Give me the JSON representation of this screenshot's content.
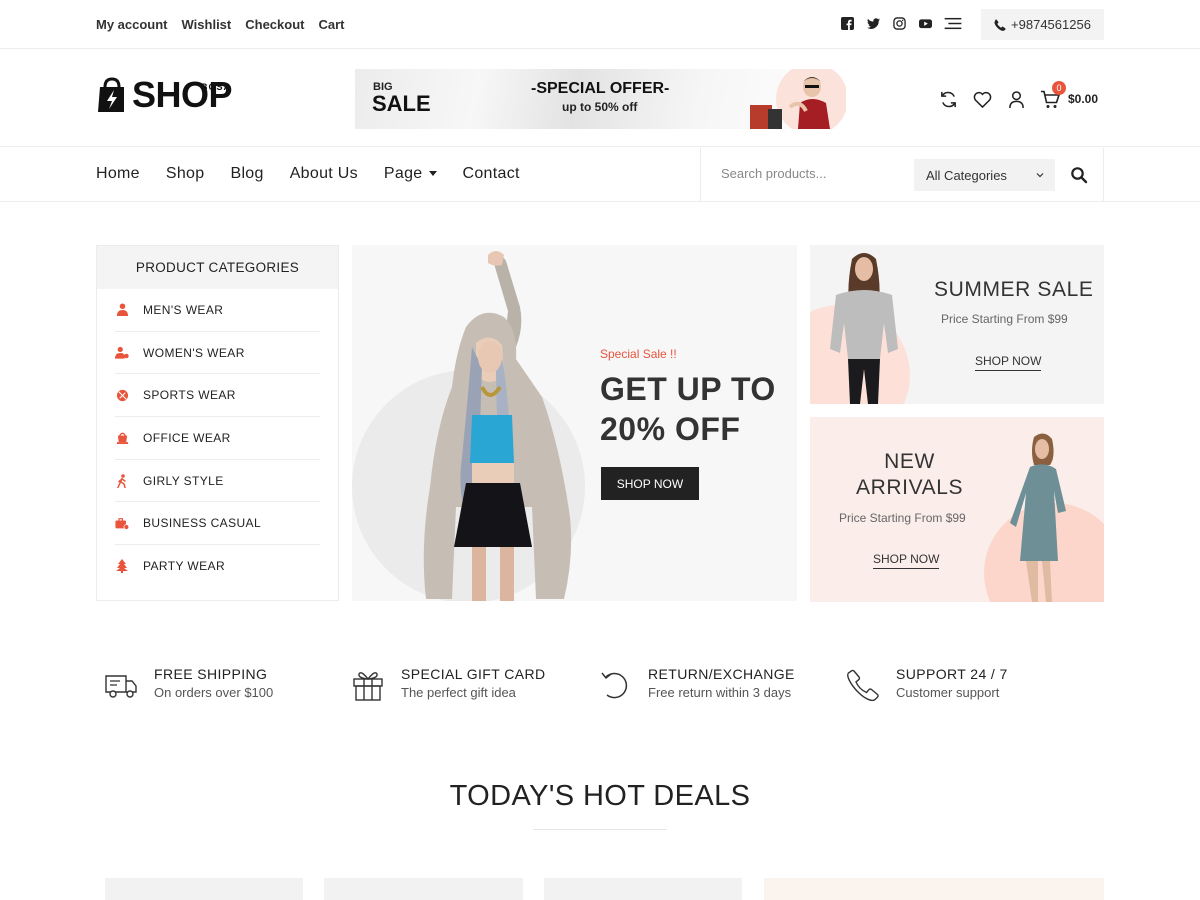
{
  "topbar": {
    "links": [
      "My account",
      "Wishlist",
      "Checkout",
      "Cart"
    ],
    "socials": [
      "facebook-icon",
      "twitter-icon",
      "instagram-icon",
      "youtube-icon",
      "menu-icon"
    ],
    "phone": "+9874561256"
  },
  "header": {
    "logo_text": "SHOP",
    "logo_sup": "BOSA",
    "banner": {
      "big": "BIG",
      "sale": "SALE",
      "offer": "-SPECIAL OFFER-",
      "upto": "up to 50% off"
    },
    "icons": [
      "refresh-icon",
      "heart-icon",
      "user-icon",
      "cart-icon"
    ],
    "cart_count": "0",
    "cart_total": "$0.00"
  },
  "nav": {
    "items": [
      "Home",
      "Shop",
      "Blog",
      "About Us",
      "Page",
      "Contact"
    ],
    "search_placeholder": "Search products...",
    "category_select": "All Categories"
  },
  "sidebar": {
    "title": "PRODUCT CATEGORIES",
    "items": [
      {
        "label": "MEN'S WEAR",
        "icon": "man-icon"
      },
      {
        "label": "WOMEN'S WEAR",
        "icon": "woman-icon"
      },
      {
        "label": "SPORTS WEAR",
        "icon": "ball-icon"
      },
      {
        "label": "OFFICE WEAR",
        "icon": "briefcase-icon"
      },
      {
        "label": "GIRLY STYLE",
        "icon": "walking-icon"
      },
      {
        "label": "BUSINESS CASUAL",
        "icon": "suitcase-icon"
      },
      {
        "label": "PARTY WEAR",
        "icon": "tree-icon"
      }
    ]
  },
  "hero": {
    "special": "Special Sale !!",
    "title_line1": "GET UP TO",
    "title_line2": "20% OFF",
    "button": "SHOP NOW"
  },
  "promos": {
    "summer": {
      "title": "SUMMER SALE",
      "sub": "Price Starting From $99",
      "link": "SHOP NOW"
    },
    "new": {
      "title_line1": "NEW",
      "title_line2": "ARRIVALS",
      "sub": "Price Starting From $99",
      "link": "SHOP NOW"
    }
  },
  "features": [
    {
      "title": "FREE SHIPPING",
      "sub": "On orders over $100",
      "icon": "truck-icon"
    },
    {
      "title": "SPECIAL GIFT CARD",
      "sub": "The perfect gift idea",
      "icon": "gift-icon"
    },
    {
      "title": "RETURN/EXCHANGE",
      "sub": "Free return within 3 days",
      "icon": "return-icon"
    },
    {
      "title": "SUPPORT 24 / 7",
      "sub": "Customer support",
      "icon": "phone-icon"
    }
  ],
  "deals": {
    "title": "TODAY'S HOT DEALS"
  },
  "colors": {
    "accent": "#e8543c",
    "dark": "#222222",
    "light_bg": "#f4f4f4"
  }
}
